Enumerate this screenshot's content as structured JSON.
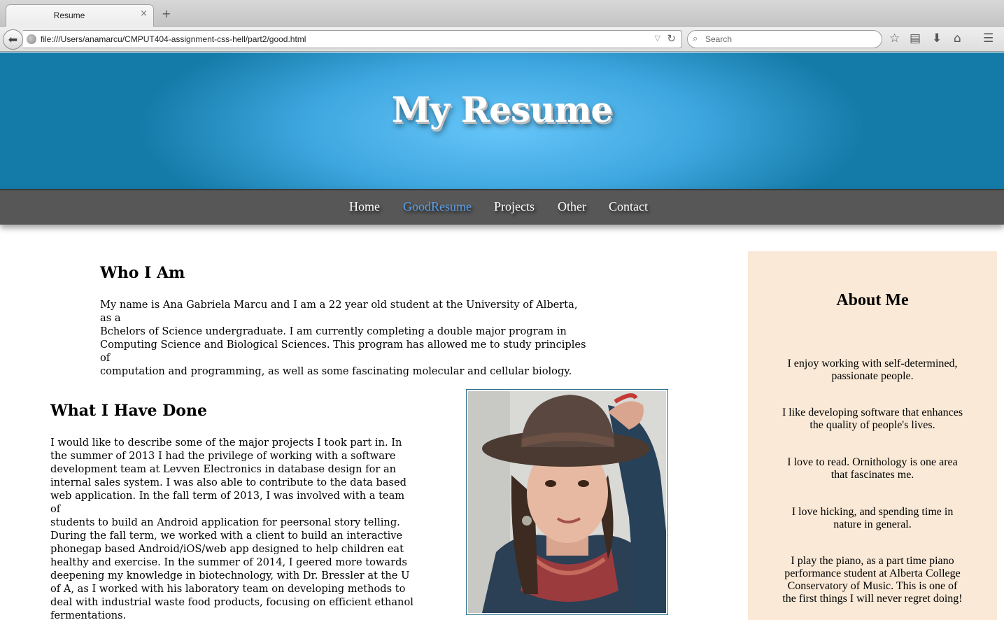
{
  "browser": {
    "tab_title": "Resume",
    "tab_close": "×",
    "new_tab": "+",
    "url": "file:///Users/anamarcu/CMPUT404-assignment-css-hell/part2/good.html",
    "search_placeholder": "Search",
    "icons": [
      "back-icon",
      "globe-icon",
      "dropdown-icon",
      "reload-icon",
      "search-icon",
      "bookmark-star-icon",
      "reading-list-icon",
      "download-icon",
      "home-icon",
      "menu-icon"
    ]
  },
  "header": {
    "title": "My Resume"
  },
  "menu": {
    "items": [
      {
        "label": "Home"
      },
      {
        "label": "GoodResume",
        "active": true
      },
      {
        "label": "Projects"
      },
      {
        "label": "Other"
      },
      {
        "label": "Contact"
      }
    ],
    "active_color": "#5a9ee8"
  },
  "who": {
    "heading": "Who I Am",
    "lines": [
      "My name is Ana Gabriela Marcu and I am a 22 year old student at the University of Alberta, as a",
      "Bchelors of Science undergraduate. I am currently completing a double major program in",
      "Computing Science and Biological Sciences. This program has allowed me to study principles of",
      "computation and programming, as well as some fascinating molecular and cellular biology."
    ]
  },
  "done": {
    "heading": "What I Have Done",
    "lines": [
      "I would like to describe some of the major projects I took part in. In",
      "the summer of 2013 I had the privilege of working with a software",
      "development team at Levven Electronics in database design for an",
      "internal sales system. I was also able to contribute to the data based",
      "web application. In the fall term of 2013, I was involved with a team of",
      "students to build an Android application for peersonal story telling.",
      "During the fall term, we worked with a client to build an interactive",
      "phonegap based Android/iOS/web app designed to help children eat",
      "healthy and exercise. In the summer of 2014, I geered more towards",
      "deepening my knowledge in biotechnology, with Dr. Bressler at the U",
      "of A, as I worked with his laboratory team on developing methods to",
      "deal with industrial waste food products, focusing on efficient ethanol",
      "fermentations."
    ]
  },
  "about": {
    "heading": "About Me",
    "items": [
      {
        "lines": [
          "I enjoy working with self-determined,",
          "passionate people."
        ]
      },
      {
        "lines": [
          "I like developing software that enhances",
          "the quality of people's lives."
        ]
      },
      {
        "lines": [
          "I love to read. Ornithology is one area",
          "that fascinates me."
        ]
      },
      {
        "lines": [
          "I love hicking, and spending time in",
          "nature in general."
        ]
      },
      {
        "lines": [
          "I play the piano, as a part time piano",
          "performance student at Alberta College",
          "Conservatory of Music. This is one of",
          "the first things I will never regret doing!"
        ]
      }
    ],
    "background_color": "#fae9d6"
  },
  "colors": {
    "hero_light": "#66c6fa",
    "hero_dark": "#147aa8",
    "menu_bg": "#575757"
  }
}
